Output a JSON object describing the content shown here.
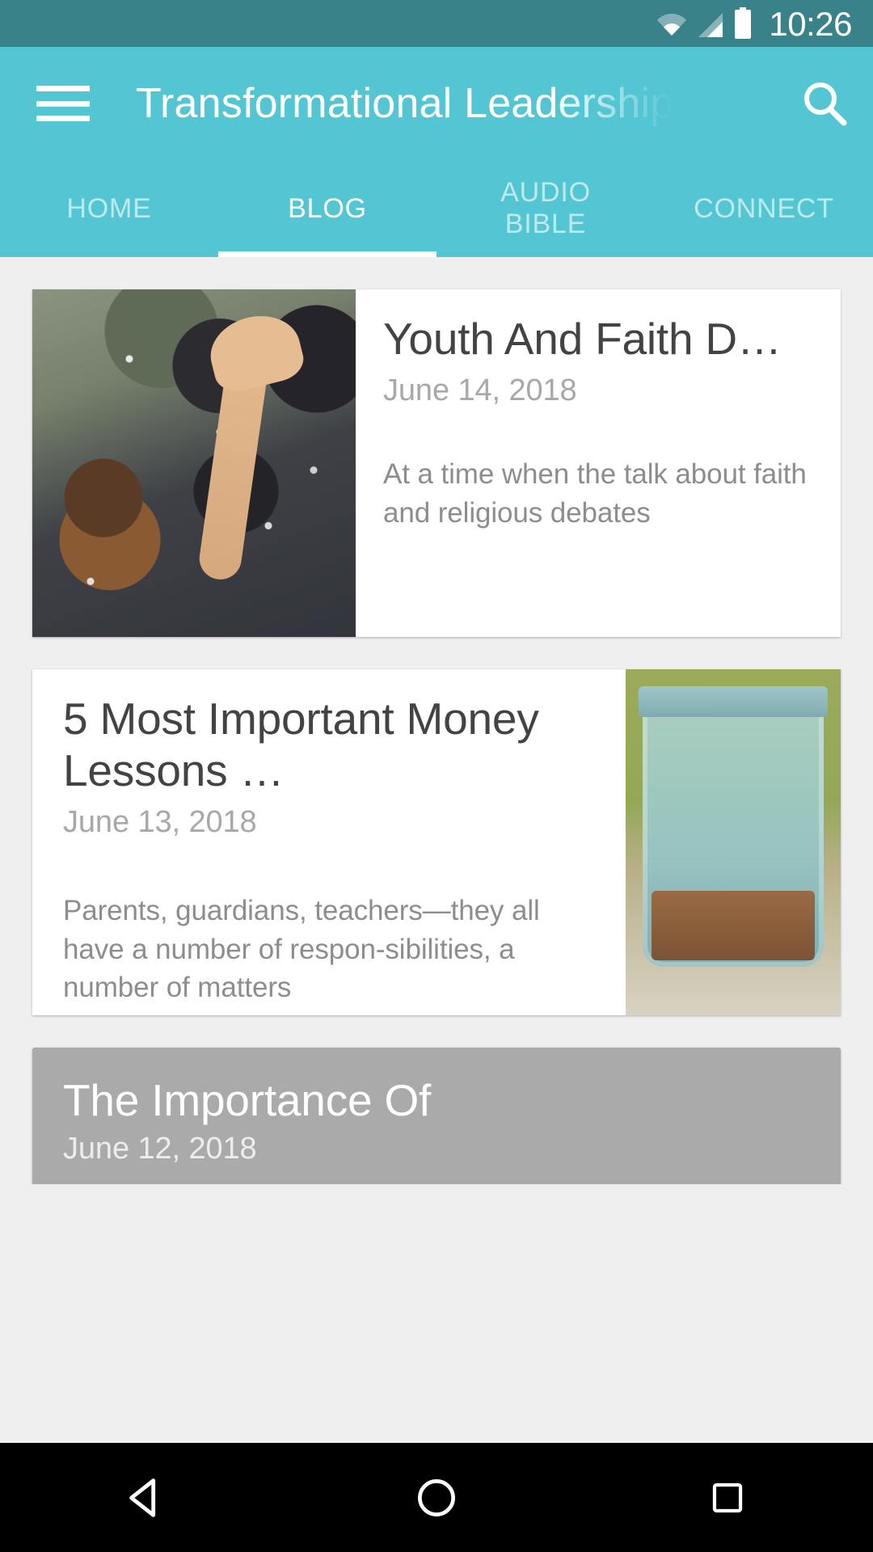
{
  "status_bar": {
    "time": "10:26",
    "icons": [
      "wifi-icon",
      "signal-icon",
      "battery-icon"
    ],
    "background_color": "#3a8289"
  },
  "app_bar": {
    "menu_icon": "hamburger-menu-icon",
    "title": "Transformational Leadership",
    "search_icon": "search-icon",
    "background_color": "#54c5d3",
    "text_color": "#ffffff"
  },
  "tabs": {
    "active_index": 1,
    "items": [
      {
        "label": "HOME"
      },
      {
        "label": "BLOG"
      },
      {
        "label": "AUDIO\nBIBLE"
      },
      {
        "label": "CONNECT"
      }
    ],
    "indicator_color": "#ffffff"
  },
  "blog_posts": [
    {
      "title": "Youth And Faith D…",
      "date": "June 14, 2018",
      "excerpt": "At a time when the talk about faith and religious debates",
      "image_position": "left",
      "image_alt": "crowd-of-people-outdoors-photo",
      "state": "normal"
    },
    {
      "title": "5 Most Important Money Lessons …",
      "date": "June 13, 2018",
      "excerpt": "Parents, guardians, teachers—they all have a number of respon-sibilities, a number of matters",
      "image_position": "right",
      "image_alt": "glass-jar-with-coins-on-windowsill-photo",
      "state": "normal"
    },
    {
      "title": "The Importance Of",
      "date": "June 12, 2018",
      "excerpt": "",
      "image_position": "none",
      "image_alt": "",
      "state": "pressed"
    }
  ],
  "nav_bar": {
    "back_label": "back-button",
    "home_label": "home-button",
    "recents_label": "recent-apps-button",
    "background_color": "#000000"
  }
}
